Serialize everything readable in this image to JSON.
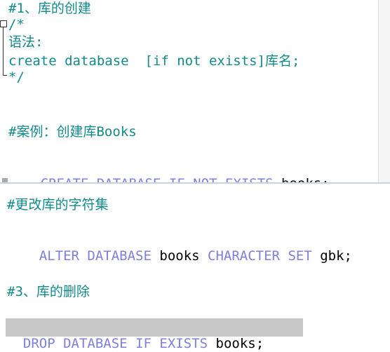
{
  "top_pane": {
    "lines": [
      "#1、库的创建",
      "/*",
      "语法:",
      "create database  [if not exists]库名;",
      "*/",
      "#案例：创建库Books"
    ],
    "stmt_kw1": "CREATE",
    "stmt_kw2": "DATABASE",
    "stmt_kw3": "IF",
    "stmt_kw4": "NOT",
    "stmt_kw5": "EXISTS",
    "stmt_ident": "books;"
  },
  "bottom_pane": {
    "comment1": "#更改库的字符集",
    "alter_kw1": "ALTER",
    "alter_kw2": "DATABASE",
    "alter_ident1": "books",
    "alter_kw3": "CHARACTER",
    "alter_kw4": "SET",
    "alter_ident2": "gbk;",
    "comment2": "#3、库的删除",
    "drop_kw1": "DROP",
    "drop_kw2": "DATABASE",
    "drop_kw3": "IF",
    "drop_kw4": "EXISTS",
    "drop_ident": "books;"
  },
  "colors": {
    "comment": "#138a8a",
    "keyword": "#7f7fdc",
    "identifier": "#000000",
    "selection": "#c8c8c8"
  }
}
